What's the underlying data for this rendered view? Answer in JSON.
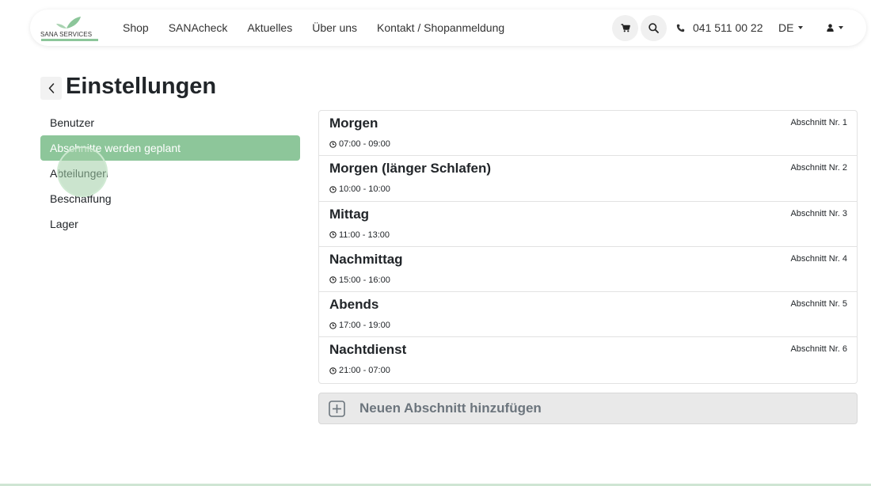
{
  "brand": {
    "name": "SANA SERVICES",
    "leaf_color": "#8cc69a",
    "accent": "#8dc69a"
  },
  "nav": {
    "links": [
      "Shop",
      "SANAcheck",
      "Aktuelles",
      "Über uns",
      "Kontakt / Shopanmeldung"
    ],
    "cart_icon": "cart-icon",
    "search_icon": "search-icon",
    "phone_icon": "phone-icon",
    "phone": "041 511 00 22",
    "language": "DE",
    "user_icon": "user-icon"
  },
  "page": {
    "title": "Einstellungen",
    "back_icon": "chevron-left-icon"
  },
  "sidebar": {
    "items": [
      {
        "label": "Benutzer",
        "active": false
      },
      {
        "label": "Abschnitte werden geplant",
        "active": true
      },
      {
        "label": "Abteilungen",
        "active": false
      },
      {
        "label": "Beschaffung",
        "active": false
      },
      {
        "label": "Lager",
        "active": false
      }
    ]
  },
  "sections": [
    {
      "name": "Morgen",
      "time": "07:00 - 09:00",
      "badge": "Abschnitt Nr. 1"
    },
    {
      "name": "Morgen (länger Schlafen)",
      "time": "10:00 - 10:00",
      "badge": "Abschnitt Nr. 2"
    },
    {
      "name": "Mittag",
      "time": "11:00 - 13:00",
      "badge": "Abschnitt Nr. 3"
    },
    {
      "name": "Nachmittag",
      "time": "15:00 - 16:00",
      "badge": "Abschnitt Nr. 4"
    },
    {
      "name": "Abends",
      "time": "17:00 - 19:00",
      "badge": "Abschnitt Nr. 5"
    },
    {
      "name": "Nachtdienst",
      "time": "21:00 - 07:00",
      "badge": "Abschnitt Nr. 6"
    }
  ],
  "add_section": {
    "label": "Neuen Abschnitt hinzufügen",
    "icon": "plus-square-icon"
  }
}
